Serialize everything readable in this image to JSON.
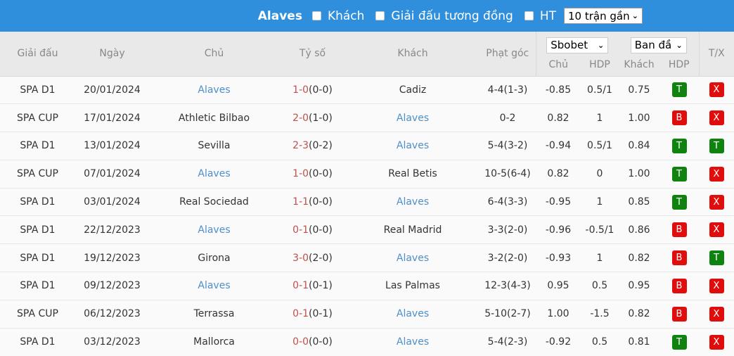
{
  "topbar": {
    "team": "Alaves",
    "filters": [
      {
        "label": "Khách",
        "checked": false
      },
      {
        "label": "Giải đấu tương đồng",
        "checked": false
      },
      {
        "label": "HT",
        "checked": false
      }
    ],
    "range_select": "10 trận gần"
  },
  "header": {
    "league": "Giải đấu",
    "date": "Ngày",
    "home": "Chủ",
    "score": "Tỷ số",
    "away": "Khách",
    "corners": "Phạt góc",
    "bookmaker_select": "Sbobet",
    "odds_type_select": "Ban đầ",
    "odds_home": "Chủ",
    "odds_hdp": "HDP",
    "odds_away": "Khách",
    "result_hdp": "HDP",
    "result_ou": "T/X"
  },
  "colors": {
    "topbar": "#2f8fdc",
    "team_link": "#4f8fc9",
    "score_red": "#c0504d",
    "badge_win": "#108210",
    "badge_lose": "#e00d0d"
  },
  "rows": [
    {
      "league": "SPA D1",
      "date": "20/01/2024",
      "home": "Alaves",
      "home_link": true,
      "ft_a": "1",
      "ft_b": "0",
      "ht": "(0-0)",
      "away": "Cadiz",
      "away_link": false,
      "corners": "4-4(1-3)",
      "odds_home": "-0.85",
      "hdp": "0.5/1",
      "odds_away": "0.75",
      "res_hdp": "T",
      "res_ou": "X"
    },
    {
      "league": "SPA CUP",
      "date": "17/01/2024",
      "home": "Athletic Bilbao",
      "home_link": false,
      "ft_a": "2",
      "ft_b": "0",
      "ht": "(1-0)",
      "away": "Alaves",
      "away_link": true,
      "corners": "0-2",
      "odds_home": "0.82",
      "hdp": "1",
      "odds_away": "1.00",
      "res_hdp": "B",
      "res_ou": "X"
    },
    {
      "league": "SPA D1",
      "date": "13/01/2024",
      "home": "Sevilla",
      "home_link": false,
      "ft_a": "2",
      "ft_b": "3",
      "ht": "(0-2)",
      "away": "Alaves",
      "away_link": true,
      "corners": "5-4(3-2)",
      "odds_home": "-0.94",
      "hdp": "0.5/1",
      "odds_away": "0.84",
      "res_hdp": "T",
      "res_ou": "T"
    },
    {
      "league": "SPA CUP",
      "date": "07/01/2024",
      "home": "Alaves",
      "home_link": true,
      "ft_a": "1",
      "ft_b": "0",
      "ht": "(0-0)",
      "away": "Real Betis",
      "away_link": false,
      "corners": "10-5(6-4)",
      "odds_home": "0.82",
      "hdp": "0",
      "odds_away": "1.00",
      "res_hdp": "T",
      "res_ou": "X"
    },
    {
      "league": "SPA D1",
      "date": "03/01/2024",
      "home": "Real Sociedad",
      "home_link": false,
      "ft_a": "1",
      "ft_b": "1",
      "ht": "(0-0)",
      "away": "Alaves",
      "away_link": true,
      "corners": "6-4(3-3)",
      "odds_home": "-0.95",
      "hdp": "1",
      "odds_away": "0.85",
      "res_hdp": "T",
      "res_ou": "X"
    },
    {
      "league": "SPA D1",
      "date": "22/12/2023",
      "home": "Alaves",
      "home_link": true,
      "ft_a": "0",
      "ft_b": "1",
      "ht": "(0-0)",
      "away": "Real Madrid",
      "away_link": false,
      "corners": "3-3(2-0)",
      "odds_home": "-0.96",
      "hdp": "-0.5/1",
      "odds_away": "0.86",
      "res_hdp": "B",
      "res_ou": "X"
    },
    {
      "league": "SPA D1",
      "date": "19/12/2023",
      "home": "Girona",
      "home_link": false,
      "ft_a": "3",
      "ft_b": "0",
      "ht": "(2-0)",
      "away": "Alaves",
      "away_link": true,
      "corners": "3-2(2-0)",
      "odds_home": "-0.93",
      "hdp": "1",
      "odds_away": "0.82",
      "res_hdp": "B",
      "res_ou": "T"
    },
    {
      "league": "SPA D1",
      "date": "09/12/2023",
      "home": "Alaves",
      "home_link": true,
      "ft_a": "0",
      "ft_b": "1",
      "ht": "(0-1)",
      "away": "Las Palmas",
      "away_link": false,
      "corners": "12-3(4-3)",
      "odds_home": "0.95",
      "hdp": "0.5",
      "odds_away": "0.95",
      "res_hdp": "B",
      "res_ou": "X"
    },
    {
      "league": "SPA CUP",
      "date": "06/12/2023",
      "home": "Terrassa",
      "home_link": false,
      "ft_a": "0",
      "ft_b": "1",
      "ht": "(0-1)",
      "away": "Alaves",
      "away_link": true,
      "corners": "5-10(2-7)",
      "odds_home": "1.00",
      "hdp": "-1.5",
      "odds_away": "0.82",
      "res_hdp": "B",
      "res_ou": "X"
    },
    {
      "league": "SPA D1",
      "date": "03/12/2023",
      "home": "Mallorca",
      "home_link": false,
      "ft_a": "0",
      "ft_b": "0",
      "ht": "(0-0)",
      "away": "Alaves",
      "away_link": true,
      "corners": "5-4(2-3)",
      "odds_home": "-0.92",
      "hdp": "0.5",
      "odds_away": "0.81",
      "res_hdp": "T",
      "res_ou": "X"
    }
  ]
}
